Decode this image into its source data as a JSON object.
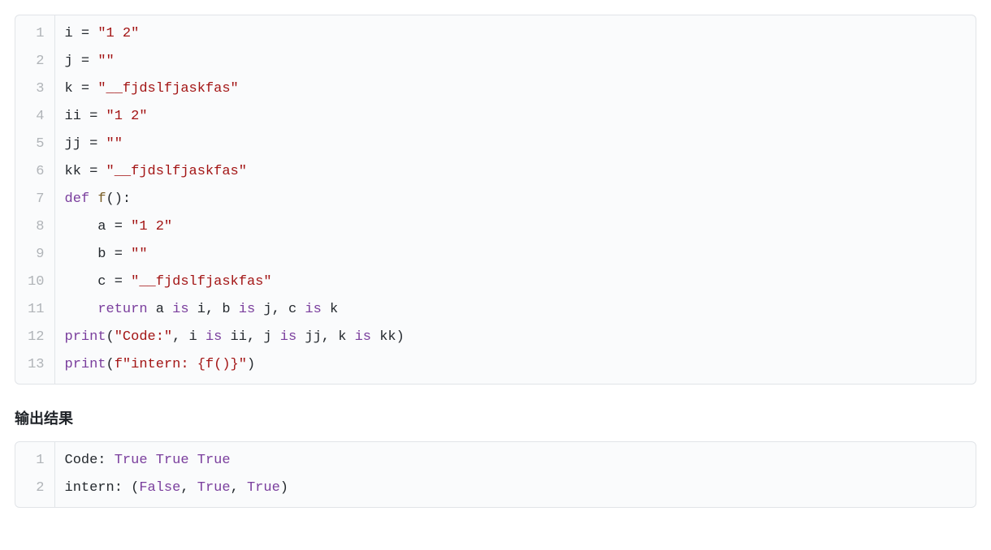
{
  "code": {
    "lines": [
      {
        "n": "1",
        "tokens": [
          [
            "t-plain",
            "i = "
          ],
          [
            "t-str",
            "\"1 2\""
          ]
        ]
      },
      {
        "n": "2",
        "tokens": [
          [
            "t-plain",
            "j = "
          ],
          [
            "t-str",
            "\"\""
          ]
        ]
      },
      {
        "n": "3",
        "tokens": [
          [
            "t-plain",
            "k = "
          ],
          [
            "t-str",
            "\"__fjdslfjaskfas\""
          ]
        ]
      },
      {
        "n": "4",
        "tokens": [
          [
            "t-plain",
            "ii = "
          ],
          [
            "t-str",
            "\"1 2\""
          ]
        ]
      },
      {
        "n": "5",
        "tokens": [
          [
            "t-plain",
            "jj = "
          ],
          [
            "t-str",
            "\"\""
          ]
        ]
      },
      {
        "n": "6",
        "tokens": [
          [
            "t-plain",
            "kk = "
          ],
          [
            "t-str",
            "\"__fjdslfjaskfas\""
          ]
        ]
      },
      {
        "n": "7",
        "tokens": [
          [
            "t-kw",
            "def"
          ],
          [
            "t-plain",
            " "
          ],
          [
            "t-fn",
            "f"
          ],
          [
            "t-plain",
            "():"
          ]
        ]
      },
      {
        "n": "8",
        "tokens": [
          [
            "t-plain",
            "    a = "
          ],
          [
            "t-str",
            "\"1 2\""
          ]
        ]
      },
      {
        "n": "9",
        "tokens": [
          [
            "t-plain",
            "    b = "
          ],
          [
            "t-str",
            "\"\""
          ]
        ]
      },
      {
        "n": "10",
        "tokens": [
          [
            "t-plain",
            "    c = "
          ],
          [
            "t-str",
            "\"__fjdslfjaskfas\""
          ]
        ]
      },
      {
        "n": "11",
        "tokens": [
          [
            "t-plain",
            "    "
          ],
          [
            "t-kw",
            "return"
          ],
          [
            "t-plain",
            " a "
          ],
          [
            "t-op",
            "is"
          ],
          [
            "t-plain",
            " i, b "
          ],
          [
            "t-op",
            "is"
          ],
          [
            "t-plain",
            " j, c "
          ],
          [
            "t-op",
            "is"
          ],
          [
            "t-plain",
            " k"
          ]
        ]
      },
      {
        "n": "12",
        "tokens": [
          [
            "t-kw",
            "print"
          ],
          [
            "t-plain",
            "("
          ],
          [
            "t-str",
            "\"Code:\""
          ],
          [
            "t-plain",
            ", i "
          ],
          [
            "t-op",
            "is"
          ],
          [
            "t-plain",
            " ii, j "
          ],
          [
            "t-op",
            "is"
          ],
          [
            "t-plain",
            " jj, k "
          ],
          [
            "t-op",
            "is"
          ],
          [
            "t-plain",
            " kk)"
          ]
        ]
      },
      {
        "n": "13",
        "tokens": [
          [
            "t-kw",
            "print"
          ],
          [
            "t-plain",
            "("
          ],
          [
            "t-str",
            "f\"intern: {f()}\""
          ],
          [
            "t-plain",
            ")"
          ]
        ]
      }
    ]
  },
  "heading": "输出结果",
  "output": {
    "lines": [
      {
        "n": "1",
        "tokens": [
          [
            "t-plain",
            "Code: "
          ],
          [
            "t-bool",
            "True"
          ],
          [
            "t-plain",
            " "
          ],
          [
            "t-bool",
            "True"
          ],
          [
            "t-plain",
            " "
          ],
          [
            "t-bool",
            "True"
          ]
        ]
      },
      {
        "n": "2",
        "tokens": [
          [
            "t-plain",
            "intern: ("
          ],
          [
            "t-bool",
            "False"
          ],
          [
            "t-plain",
            ", "
          ],
          [
            "t-bool",
            "True"
          ],
          [
            "t-plain",
            ", "
          ],
          [
            "t-bool",
            "True"
          ],
          [
            "t-plain",
            ")"
          ]
        ]
      }
    ]
  }
}
